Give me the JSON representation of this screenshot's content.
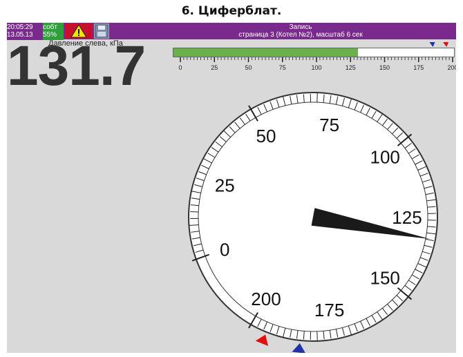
{
  "caption": "6. Циферблат.",
  "status": {
    "time": "20:05:29",
    "date": "13.05.13",
    "event_label": "собт",
    "event_percent": "55%",
    "warning_icon": "warning-icon",
    "save_icon": "floppy-disk-icon"
  },
  "record": {
    "title": "Запись",
    "subtitle": "страница 3 (Котел №2), масштаб 6 сек"
  },
  "channel": {
    "label": "Давление слева, кПа",
    "value": "131.7",
    "value_number": 131.7
  },
  "bar_scale": {
    "min": 0,
    "max": 200,
    "labels": [
      "0",
      "25",
      "50",
      "75",
      "100",
      "125",
      "150",
      "175",
      "200"
    ]
  },
  "dial": {
    "min": 0,
    "max": 200,
    "labels": [
      "0",
      "25",
      "50",
      "75",
      "100",
      "125",
      "150",
      "175",
      "200"
    ],
    "blue_marker_value": 185,
    "red_marker_value": 195
  },
  "colors": {
    "status_bar": "#7a2a8c",
    "event": "#2e9f3a",
    "warning": "#c8102e",
    "bar_fill": "#6ab04c",
    "blue_marker": "#2233aa",
    "red_marker": "#e01010"
  }
}
